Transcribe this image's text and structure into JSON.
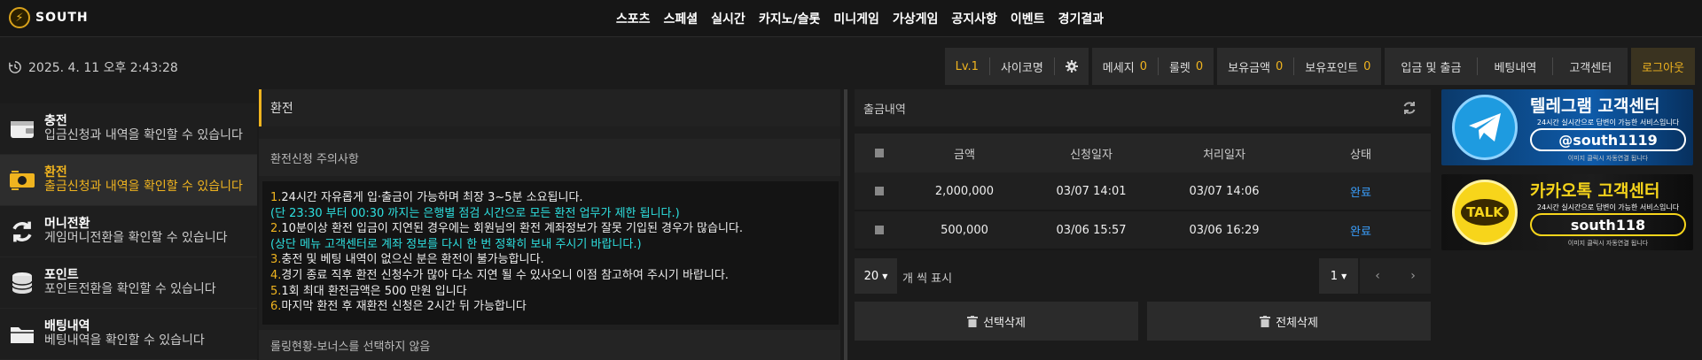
{
  "brand": {
    "logo_text": "SOUTH"
  },
  "nav": [
    "스포츠",
    "스페셜",
    "실시간",
    "카지노/슬롯",
    "미니게임",
    "가상게임",
    "공지사항",
    "이벤트",
    "경기결과"
  ],
  "infobar": {
    "datetime": "2025. 4. 11 오후 2:43:28",
    "level": "Lv.1",
    "nickname": "사이코명",
    "message_label": "메세지",
    "message_count": "0",
    "roulette_label": "룰렛",
    "roulette_count": "0",
    "money_label": "보유금액",
    "money_value": "0",
    "point_label": "보유포인트",
    "point_value": "0",
    "deposit_withdraw": "입금 및 출금",
    "bet_history": "베팅내역",
    "support": "고객센터",
    "logout": "로그아웃"
  },
  "sidebar": [
    {
      "title": "충전",
      "desc": "입금신청과 내역을 확인할 수 있습니다",
      "icon": "wallet-icon",
      "active": false
    },
    {
      "title": "환전",
      "desc": "출금신청과 내역을 확인할 수 있습니다",
      "icon": "money-exchange-icon",
      "active": true
    },
    {
      "title": "머니전환",
      "desc": "게임머니전환을 확인할 수 있습니다",
      "icon": "refresh-icon",
      "active": false
    },
    {
      "title": "포인트",
      "desc": "포인트전환을 확인할 수 있습니다",
      "icon": "coins-icon",
      "active": false
    },
    {
      "title": "배팅내역",
      "desc": "베팅내역을 확인할 수 있습니다",
      "icon": "folder-icon",
      "active": false
    }
  ],
  "exchange": {
    "title": "환전",
    "notice_header": "환전신청 주의사항",
    "notice_lines": [
      {
        "num": "1.",
        "text": "24시간 자유롭게 입·출금이 가능하며 최장 3~5분 소요됩니다.",
        "note": "(단 23:30 부터 00:30 까지는 은행별 점검 시간으로 모든 환전 업무가 제한 됩니다.)"
      },
      {
        "num": "2.",
        "text": "10분이상 환전 입금이 지연된 경우에는 회원님의 환전 계좌정보가 잘못 기입된 경우가 많습니다.",
        "note": "(상단 메뉴 고객센터로 계좌 정보를 다시 한 번 정확히 보내 주시기 바랍니다.)"
      },
      {
        "num": "3.",
        "text": "충전 및 베팅 내역이 없으신 분은 환전이 불가능합니다.",
        "note": ""
      },
      {
        "num": "4.",
        "text": "경기 종료 직후 환전 신청수가 많아 다소 지연 될 수 있사오니 이점 참고하여 주시기 바랍니다.",
        "note": ""
      },
      {
        "num": "5.",
        "text": "1회 최대 환전금액은 500 만원 입니다",
        "note": ""
      },
      {
        "num": "6.",
        "text": "마지막 환전 후 재환전 신청은 2시간 뒤 가능합니다",
        "note": ""
      }
    ],
    "rolling_header": "롤링현황-보너스를 선택하지 않음"
  },
  "history": {
    "title": "출금내역",
    "columns": [
      "금액",
      "신청일자",
      "처리일자",
      "상태"
    ],
    "rows": [
      {
        "amount": "2,000,000",
        "requested": "03/07 14:01",
        "processed": "03/07 14:06",
        "status": "완료"
      },
      {
        "amount": "500,000",
        "requested": "03/06 15:57",
        "processed": "03/06 16:29",
        "status": "완료"
      }
    ],
    "per_page": "20",
    "per_page_label": "개 씩 표시",
    "page": "1",
    "delete_selected": "선택삭제",
    "delete_all": "전체삭제"
  },
  "banners": {
    "telegram": {
      "heading": "텔레그램 고객센터",
      "sub": "24시간 실시간으로 답변이 가능한 서비스입니다",
      "id": "@south1119",
      "footer": "이미지 클릭시 자동연결 됩니다"
    },
    "kakao": {
      "heading": "카카오톡 고객센터",
      "sub": "24시간 실시간으로 답변이 가능한 서비스입니다",
      "id": "south118",
      "footer": "이미지 클릭시 자동연결 됩니다",
      "badge": "TALK"
    }
  },
  "colors": {
    "accent": "#f0b41f",
    "notice_note": "#2ee0e0",
    "status_done": "#3aa0ff"
  }
}
